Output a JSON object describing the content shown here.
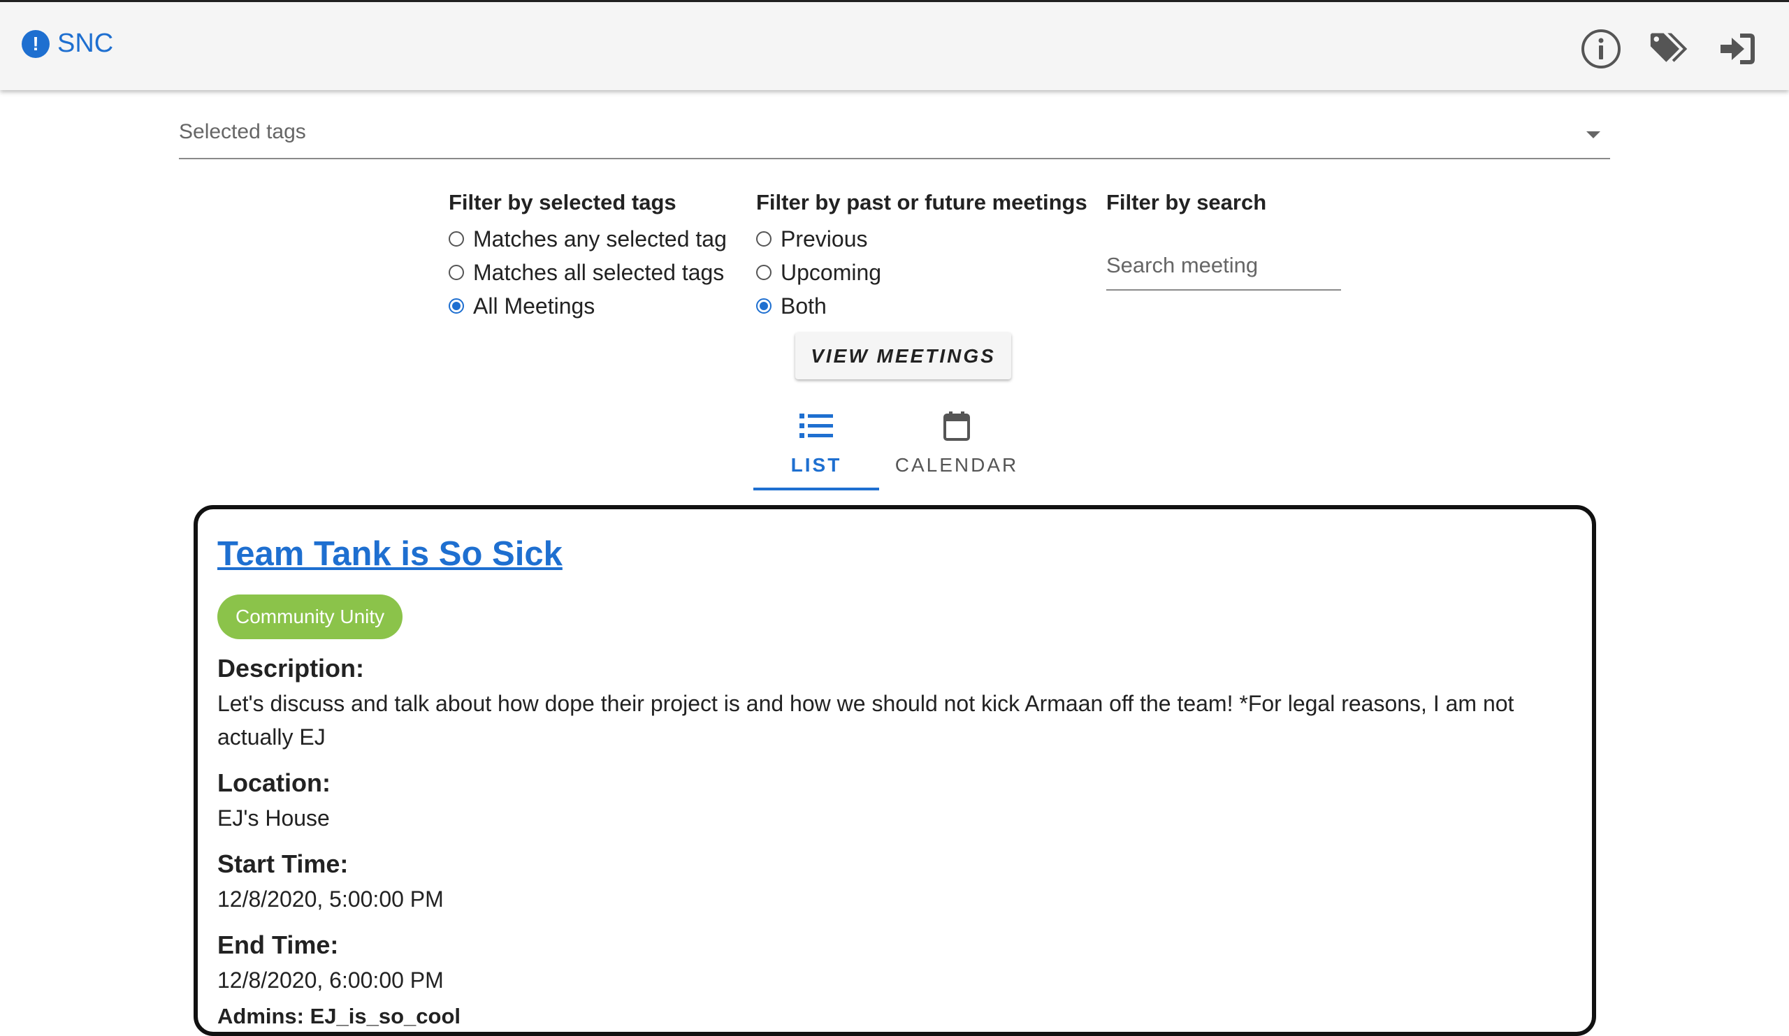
{
  "app": {
    "brand": "SNC"
  },
  "tag_select": {
    "label": "Selected tags"
  },
  "filters": {
    "tags": {
      "title": "Filter by selected tags",
      "options": [
        "Matches any selected tag",
        "Matches all selected tags",
        "All Meetings"
      ],
      "selected": "All Meetings"
    },
    "time": {
      "title": "Filter by past or future meetings",
      "options": [
        "Previous",
        "Upcoming",
        "Both"
      ],
      "selected": "Both"
    },
    "search": {
      "title": "Filter by search",
      "placeholder": "Search meeting",
      "value": ""
    }
  },
  "view_button": "VIEW MEETINGS",
  "tabs": {
    "list": "LIST",
    "calendar": "CALENDAR",
    "active": "LIST"
  },
  "meeting": {
    "title": "Team Tank is So Sick",
    "tag": "Community Unity",
    "description_label": "Description:",
    "description": "Let's discuss and talk about how dope their project is and how we should not kick Armaan off the team! *For legal reasons, I am not actually EJ",
    "location_label": "Location:",
    "location": "EJ's House",
    "start_label": "Start Time:",
    "start": "12/8/2020, 5:00:00 PM",
    "end_label": "End Time:",
    "end": "12/8/2020, 6:00:00 PM",
    "admins": "Admins: EJ_is_so_cool"
  },
  "colors": {
    "primary": "#1e6fd0",
    "chip": "#8bc34a",
    "appbar": "#f5f5f5"
  },
  "icons": [
    "alert-circle-icon",
    "info-icon",
    "tags-icon",
    "login-icon",
    "list-icon",
    "calendar-icon",
    "dropdown-arrow-icon"
  ]
}
